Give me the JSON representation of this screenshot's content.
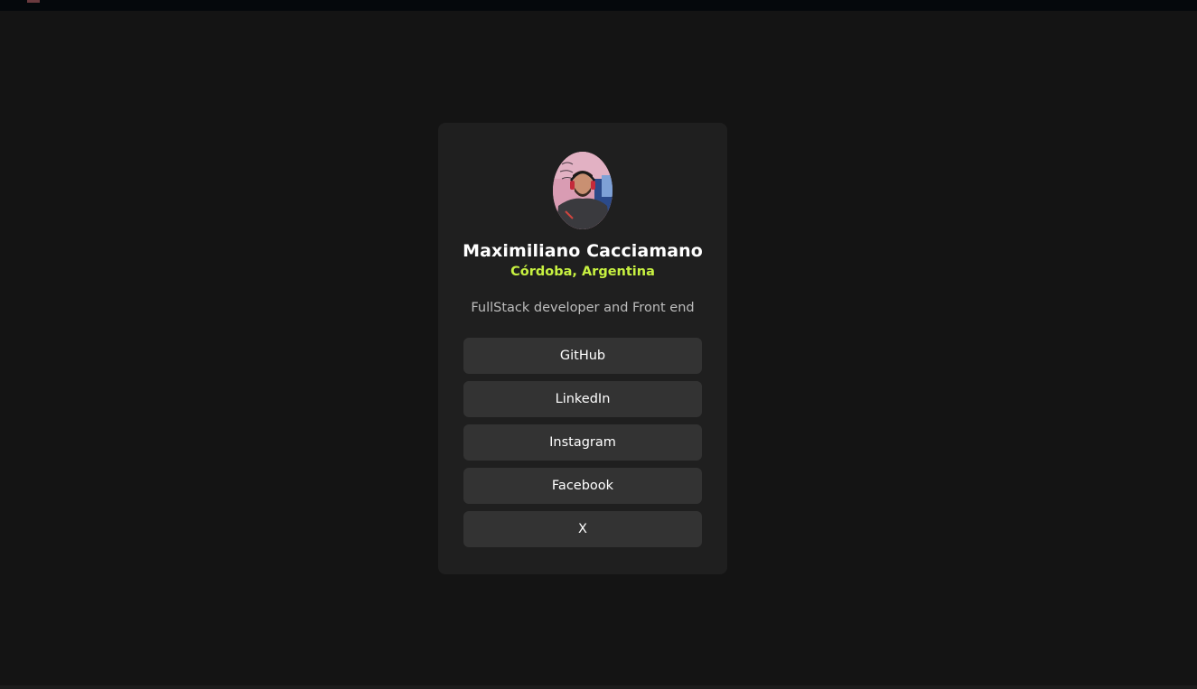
{
  "profile": {
    "name": "Maximiliano Cacciamano",
    "location": "Córdoba, Argentina",
    "bio": "FullStack developer and Front end"
  },
  "links": [
    {
      "label": "GitHub"
    },
    {
      "label": "LinkedIn"
    },
    {
      "label": "Instagram"
    },
    {
      "label": "Facebook"
    },
    {
      "label": "X"
    }
  ],
  "colors": {
    "background": "#141414",
    "card": "#1f1f1f",
    "button": "#333333",
    "accent": "#c7f141",
    "text": "#ffffff",
    "muted": "#bdbdbd"
  }
}
